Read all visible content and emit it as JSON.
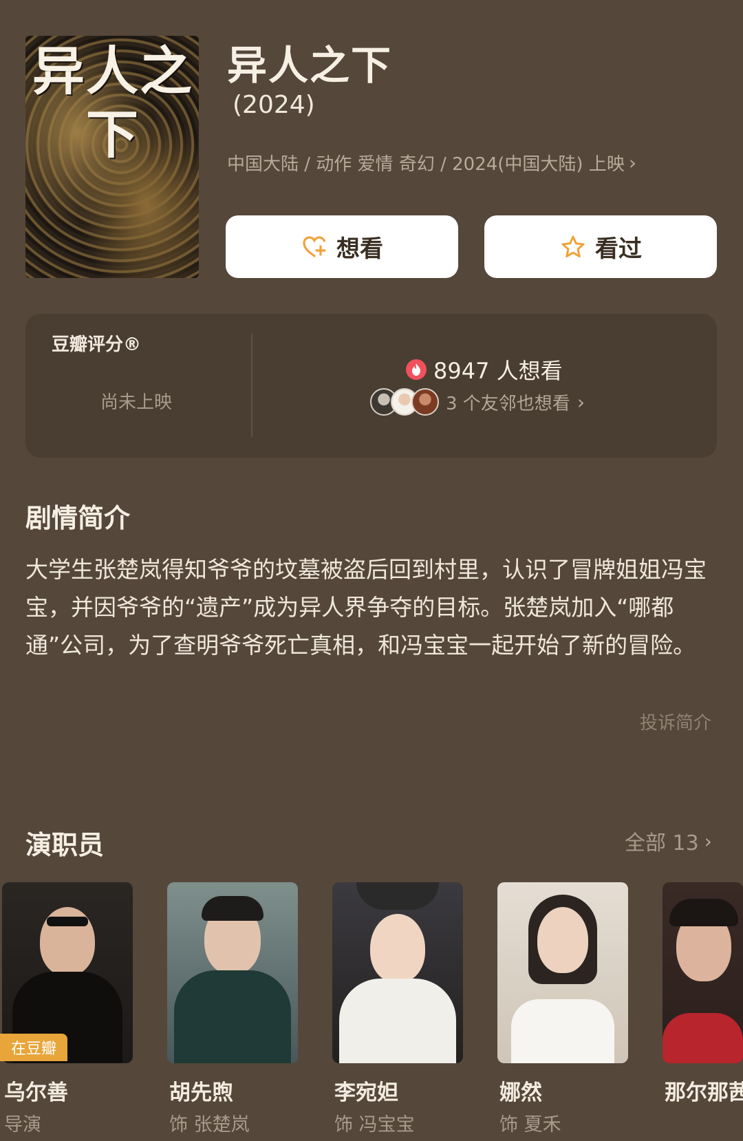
{
  "movie": {
    "poster_text": "异人之下",
    "title": "异人之下",
    "year": "(2024)",
    "meta": "中国大陆 / 动作 爱情 奇幻 / 2024(中国大陆) 上映"
  },
  "actions": {
    "want_label": "想看",
    "watched_label": "看过"
  },
  "rating": {
    "label": "豆瓣评分®",
    "value_text": "尚未上映",
    "want_count_text": "8947 人想看",
    "friends_text": "3 个友邻也想看"
  },
  "synopsis": {
    "title": "剧情简介",
    "text": "大学生张楚岚得知爷爷的坟墓被盗后回到村里，认识了冒牌姐姐冯宝宝，并因爷爷的“遗产”成为异人界争夺的目标。张楚岚加入“哪都通”公司，为了查明爷爷死亡真相，和冯宝宝一起开始了新的冒险。",
    "complain_label": "投诉简介"
  },
  "cast": {
    "title": "演职员",
    "all_label": "全部 13",
    "badge": "在豆瓣",
    "members": [
      {
        "name": "乌尔善",
        "role": "导演"
      },
      {
        "name": "胡先煦",
        "role": "饰 张楚岚"
      },
      {
        "name": "李宛妲",
        "role": "饰 冯宝宝"
      },
      {
        "name": "娜然",
        "role": "饰 夏禾"
      },
      {
        "name": "那尔那茜",
        "role": ""
      }
    ]
  },
  "colors": {
    "background": "#55473a",
    "card": "#4a3d31",
    "accent": "#f0a23b",
    "badge": "#e7a53a"
  },
  "icons": [
    "heart-plus-icon",
    "star-icon",
    "fire-icon",
    "chevron-right-icon"
  ]
}
